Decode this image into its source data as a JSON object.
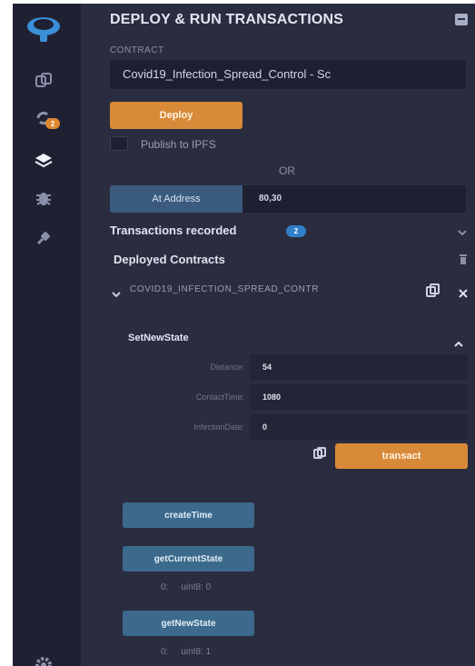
{
  "colors": {
    "rail_bg": "#1f2133",
    "panel_bg": "#2a2c3f",
    "accent_orange": "#d98a38",
    "accent_blue": "#3b6a8c",
    "badge_blue": "#2f7fc9",
    "input_bg": "#1e2031"
  },
  "rail": {
    "icons": [
      "remix-logo-icon",
      "file-explorer-icon",
      "compiler-icon",
      "deploy-run-icon",
      "debugger-icon",
      "plugin-manager-icon",
      "settings-gear-icon"
    ],
    "compiler_badge": "2"
  },
  "panel": {
    "title": "DEPLOY & RUN TRANSACTIONS",
    "contract_label": "CONTRACT",
    "contract_selected": "Covid19_Infection_Spread_Control - Sc",
    "deploy_label": "Deploy",
    "publish_label": "Publish to IPFS",
    "or_label": "OR",
    "at_address_label": "At Address",
    "at_address_value": "80,30",
    "transactions_label": "Transactions recorded",
    "transactions_count": "2",
    "deployed_label": "Deployed Contracts",
    "instance_name": "COVID19_INFECTION_SPREAD_CONTR",
    "function": {
      "name": "SetNewState",
      "params": [
        {
          "label": "Distance:",
          "value": "54"
        },
        {
          "label": "ContactTime:",
          "value": "1080"
        },
        {
          "label": "InfectionDate:",
          "value": "0"
        }
      ],
      "transact_label": "transact"
    },
    "buttons": {
      "create_time": "createTime",
      "get_current_state": "getCurrentState",
      "get_new_state": "getNewState"
    },
    "results": {
      "current_state": {
        "index": "0:",
        "value": "uint8: 0"
      },
      "new_state": {
        "index": "0:",
        "value": "uint8: 1"
      }
    }
  }
}
